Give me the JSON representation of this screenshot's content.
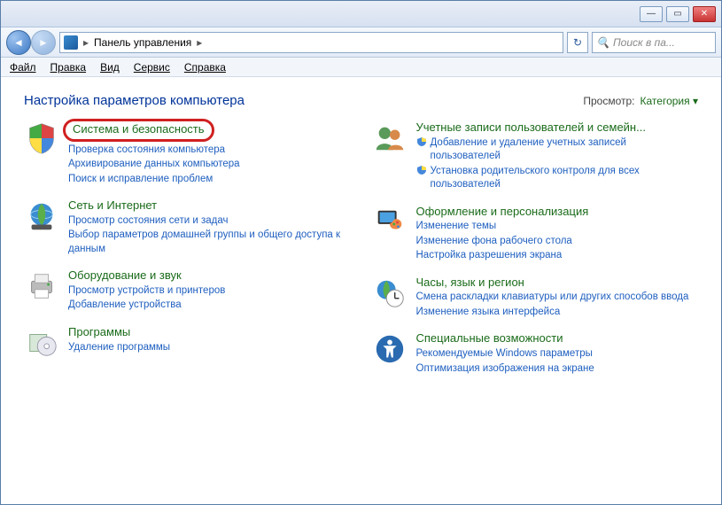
{
  "titlebar": {
    "min": "—",
    "max": "▭",
    "close": "✕"
  },
  "nav": {
    "back": "◄",
    "fwd": "►"
  },
  "address": {
    "location": "Панель управления",
    "sep1": "▸",
    "sep2": "▸"
  },
  "refresh": "↻",
  "search": {
    "icon": "🔍",
    "placeholder": "Поиск в па..."
  },
  "menu": {
    "file": "Файл",
    "edit": "Правка",
    "view": "Вид",
    "tools": "Сервис",
    "help": "Справка"
  },
  "header": {
    "title": "Настройка параметров компьютера",
    "view_label": "Просмотр:",
    "view_value": "Категория",
    "view_arrow": "▾"
  },
  "cats": {
    "system": {
      "title": "Система и безопасность",
      "links": [
        "Проверка состояния компьютера",
        "Архивирование данных компьютера",
        "Поиск и исправление проблем"
      ]
    },
    "network": {
      "title": "Сеть и Интернет",
      "links": [
        "Просмотр состояния сети и задач",
        "Выбор параметров домашней группы и общего доступа к данным"
      ]
    },
    "hardware": {
      "title": "Оборудование и звук",
      "links": [
        "Просмотр устройств и принтеров",
        "Добавление устройства"
      ]
    },
    "programs": {
      "title": "Программы",
      "links": [
        "Удаление программы"
      ]
    },
    "users": {
      "title": "Учетные записи пользователей и семейн...",
      "links": [
        "Добавление и удаление учетных записей пользователей",
        "Установка родительского контроля для всех пользователей"
      ],
      "shielded": [
        true,
        true
      ]
    },
    "appearance": {
      "title": "Оформление и персонализация",
      "links": [
        "Изменение темы",
        "Изменение фона рабочего стола",
        "Настройка разрешения экрана"
      ]
    },
    "clock": {
      "title": "Часы, язык и регион",
      "links": [
        "Смена раскладки клавиатуры или других способов ввода",
        "Изменение языка интерфейса"
      ]
    },
    "ease": {
      "title": "Специальные возможности",
      "links": [
        "Рекомендуемые Windows параметры",
        "Оптимизация изображения на экране"
      ]
    }
  }
}
